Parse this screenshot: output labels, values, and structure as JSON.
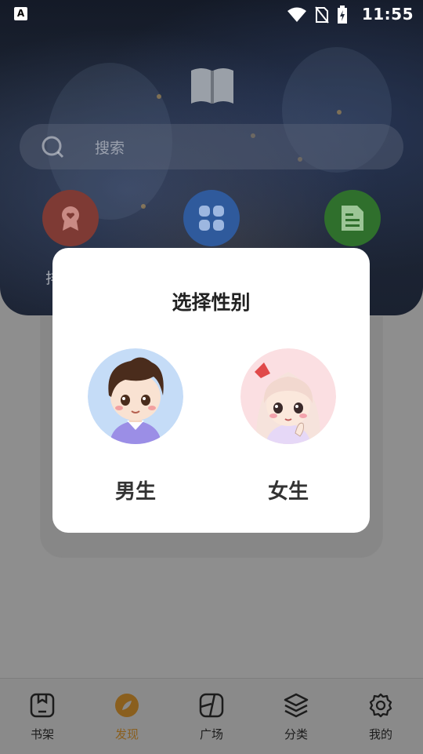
{
  "status_bar": {
    "time": "11:55",
    "indicator": "A",
    "icons": [
      "wifi-icon",
      "no-sim-icon",
      "battery-charging-icon"
    ]
  },
  "search": {
    "placeholder": "搜索"
  },
  "quick_actions": [
    {
      "icon": "badge-icon",
      "color": "#7e3a34",
      "label_fragment": "排"
    },
    {
      "icon": "grid-icon",
      "color": "#2f5a9c"
    },
    {
      "icon": "document-icon",
      "color": "#2f6f2c"
    }
  ],
  "dialog": {
    "title": "选择性别",
    "options": [
      {
        "label": "男生",
        "avatar": "boy-avatar"
      },
      {
        "label": "女生",
        "avatar": "girl-avatar"
      }
    ]
  },
  "bottom_nav": [
    {
      "label": "书架",
      "icon": "bookshelf-icon",
      "active": false
    },
    {
      "label": "发现",
      "icon": "discover-icon",
      "active": true
    },
    {
      "label": "广场",
      "icon": "square-icon",
      "active": false
    },
    {
      "label": "分类",
      "icon": "layers-icon",
      "active": false
    },
    {
      "label": "我的",
      "icon": "gear-icon",
      "active": false
    }
  ],
  "colors": {
    "accent": "#8a5f1e",
    "overlay": "#8e8e8e"
  }
}
